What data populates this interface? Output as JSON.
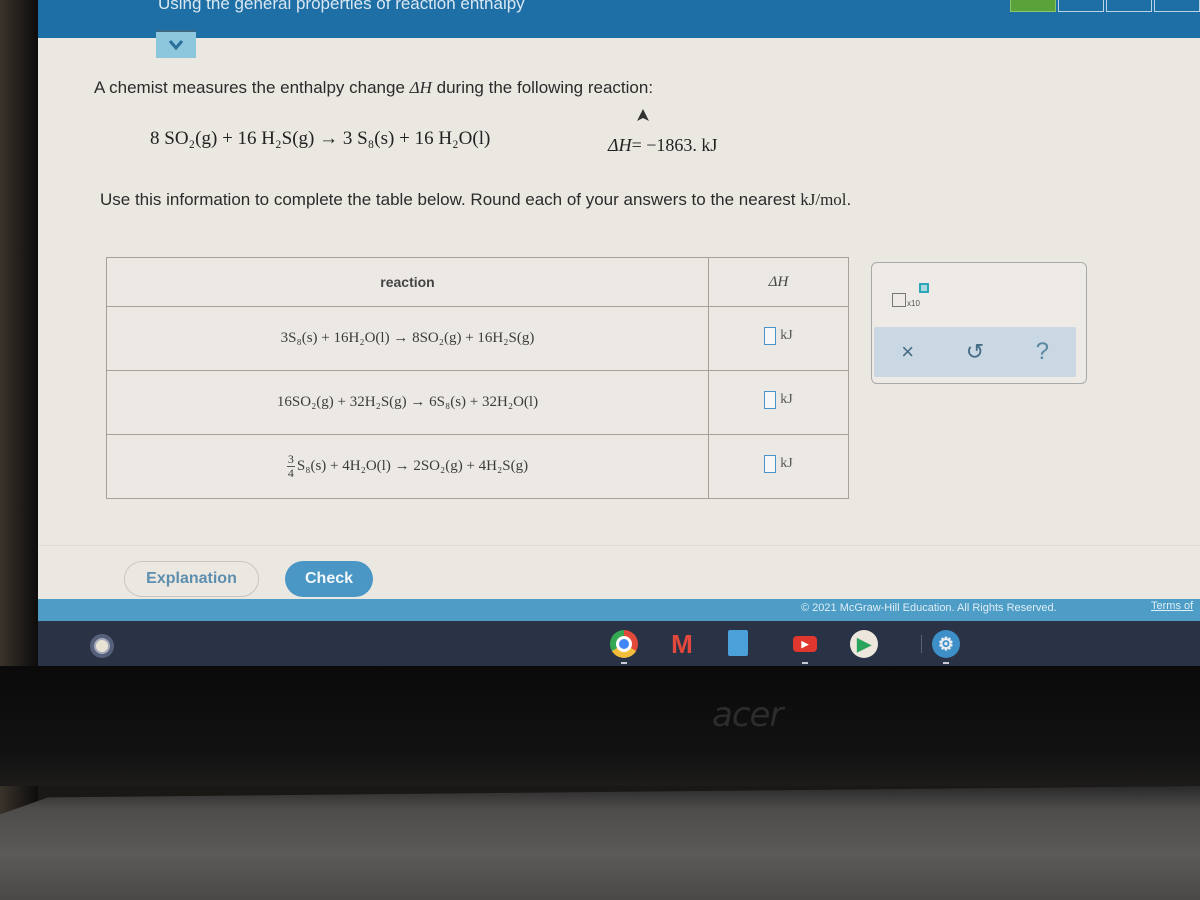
{
  "header": {
    "title": "Using the general properties of reaction enthalpy",
    "progress_segments": [
      "done",
      "pending",
      "pending",
      "pending"
    ]
  },
  "question": {
    "prompt_before": "A chemist measures the enthalpy change ",
    "prompt_symbol": "ΔH",
    "prompt_after": " during the following reaction:",
    "given_reaction": {
      "reactants": "8 SO₂(g) + 16 H₂S(g)",
      "arrow": "→",
      "products": "3 S₈(s) + 16 H₂O(l)"
    },
    "given_dh_label": "ΔH",
    "given_dh_value": "= −1863. kJ",
    "instruction_before": "Use this information to complete the table below. Round each of your answers to the nearest ",
    "instruction_unit": "kJ/mol",
    "instruction_after": "."
  },
  "table": {
    "headers": {
      "reaction": "reaction",
      "dh": "ΔH"
    },
    "rows": [
      {
        "reaction": "3S₈(s) + 16H₂O(l) → 8SO₂(g) + 16H₂S(g)",
        "answer_value": "",
        "unit": "kJ"
      },
      {
        "reaction": "16SO₂(g) + 32H₂S(g) → 6S₈(s) + 32H₂O(l)",
        "answer_value": "",
        "unit": "kJ"
      },
      {
        "coef_num": "3",
        "coef_den": "4",
        "reaction": "S₈(s) + 4H₂O(l) → 2SO₂(g) + 4H₂S(g)",
        "answer_value": "",
        "unit": "kJ"
      }
    ]
  },
  "palette": {
    "sci_notation_label": "x10",
    "clear_icon": "×",
    "undo_icon": "↺",
    "help_icon": "?"
  },
  "actions": {
    "explanation_label": "Explanation",
    "check_label": "Check"
  },
  "footer": {
    "copyright": "© 2021 McGraw-Hill Education. All Rights Reserved.",
    "terms": "Terms of"
  },
  "shelf": {
    "apps": [
      "chrome",
      "gmail",
      "docs",
      "youtube",
      "play-store",
      "settings"
    ],
    "gmail_glyph": "M",
    "youtube_glyph": "▶",
    "play_glyph": "▶",
    "settings_glyph": "⚙"
  },
  "device": {
    "brand": "acer"
  },
  "colors": {
    "header_blue": "#1d6fa5",
    "accent_blue": "#4a97c6",
    "footer_blue": "#4d9dc7",
    "progress_done": "#5aa33a"
  }
}
